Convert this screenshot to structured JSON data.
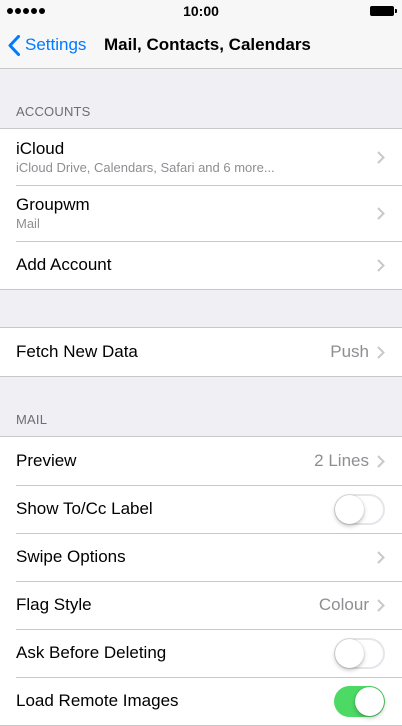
{
  "status_bar": {
    "time": "10:00"
  },
  "nav": {
    "back_label": "Settings",
    "title": "Mail, Contacts, Calendars"
  },
  "accounts": {
    "header": "ACCOUNTS",
    "items": [
      {
        "label": "iCloud",
        "sublabel": "iCloud Drive, Calendars, Safari and 6 more..."
      },
      {
        "label": "Groupwm",
        "sublabel": "Mail"
      },
      {
        "label": "Add Account"
      }
    ]
  },
  "fetch": {
    "label": "Fetch New Data",
    "value": "Push"
  },
  "mail": {
    "header": "MAIL",
    "preview": {
      "label": "Preview",
      "value": "2 Lines"
    },
    "show_tocc": {
      "label": "Show To/Cc Label",
      "on": false
    },
    "swipe": {
      "label": "Swipe Options"
    },
    "flag_style": {
      "label": "Flag Style",
      "value": "Colour"
    },
    "ask_delete": {
      "label": "Ask Before Deleting",
      "on": false
    },
    "load_images": {
      "label": "Load Remote Images",
      "on": true
    }
  },
  "colors": {
    "accent": "#007aff",
    "toggle_on": "#4cd964",
    "background": "#efeff4",
    "separator": "#c8c7cc"
  }
}
